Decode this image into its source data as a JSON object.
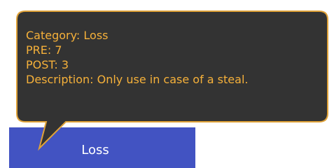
{
  "tooltip": {
    "lines": [
      "Category: Loss",
      "PRE: 7",
      "POST: 3",
      "Description: Only use in case of a steal."
    ],
    "background_color": "#333333",
    "border_color": "#e0a238",
    "text_color": "#f6b13a"
  },
  "button": {
    "label": "Loss",
    "color": "#4253c2"
  }
}
